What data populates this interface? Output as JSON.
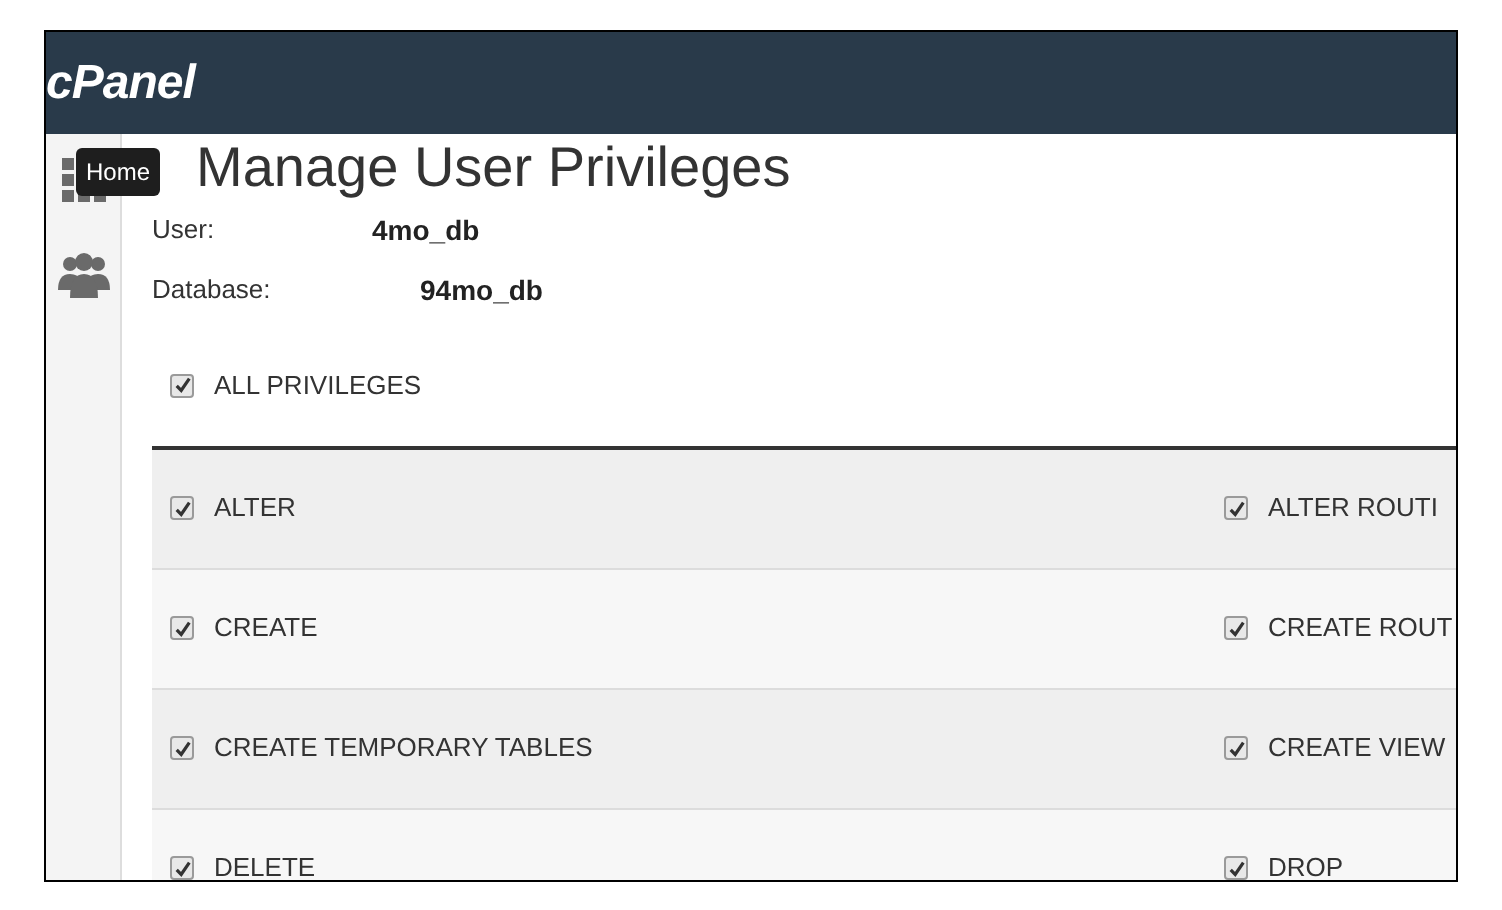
{
  "header": {
    "logo": "cPanel"
  },
  "sidebar": {
    "tooltip": "Home"
  },
  "title": "Manage User Privileges",
  "fields": [
    {
      "label": "User:",
      "value": "4mo_db"
    },
    {
      "label": "Database:",
      "value": "94mo_db"
    }
  ],
  "all_privileges": {
    "label": "ALL PRIVILEGES",
    "checked": true
  },
  "privilege_rows": [
    {
      "left": {
        "label": "ALTER",
        "checked": true
      },
      "right": {
        "label": "ALTER ROUTI",
        "checked": true
      }
    },
    {
      "left": {
        "label": "CREATE",
        "checked": true
      },
      "right": {
        "label": "CREATE ROUT",
        "checked": true
      }
    },
    {
      "left": {
        "label": "CREATE TEMPORARY TABLES",
        "checked": true
      },
      "right": {
        "label": "CREATE VIEW",
        "checked": true
      }
    },
    {
      "left": {
        "label": "DELETE",
        "checked": true
      },
      "right": {
        "label": "DROP",
        "checked": true
      }
    }
  ]
}
